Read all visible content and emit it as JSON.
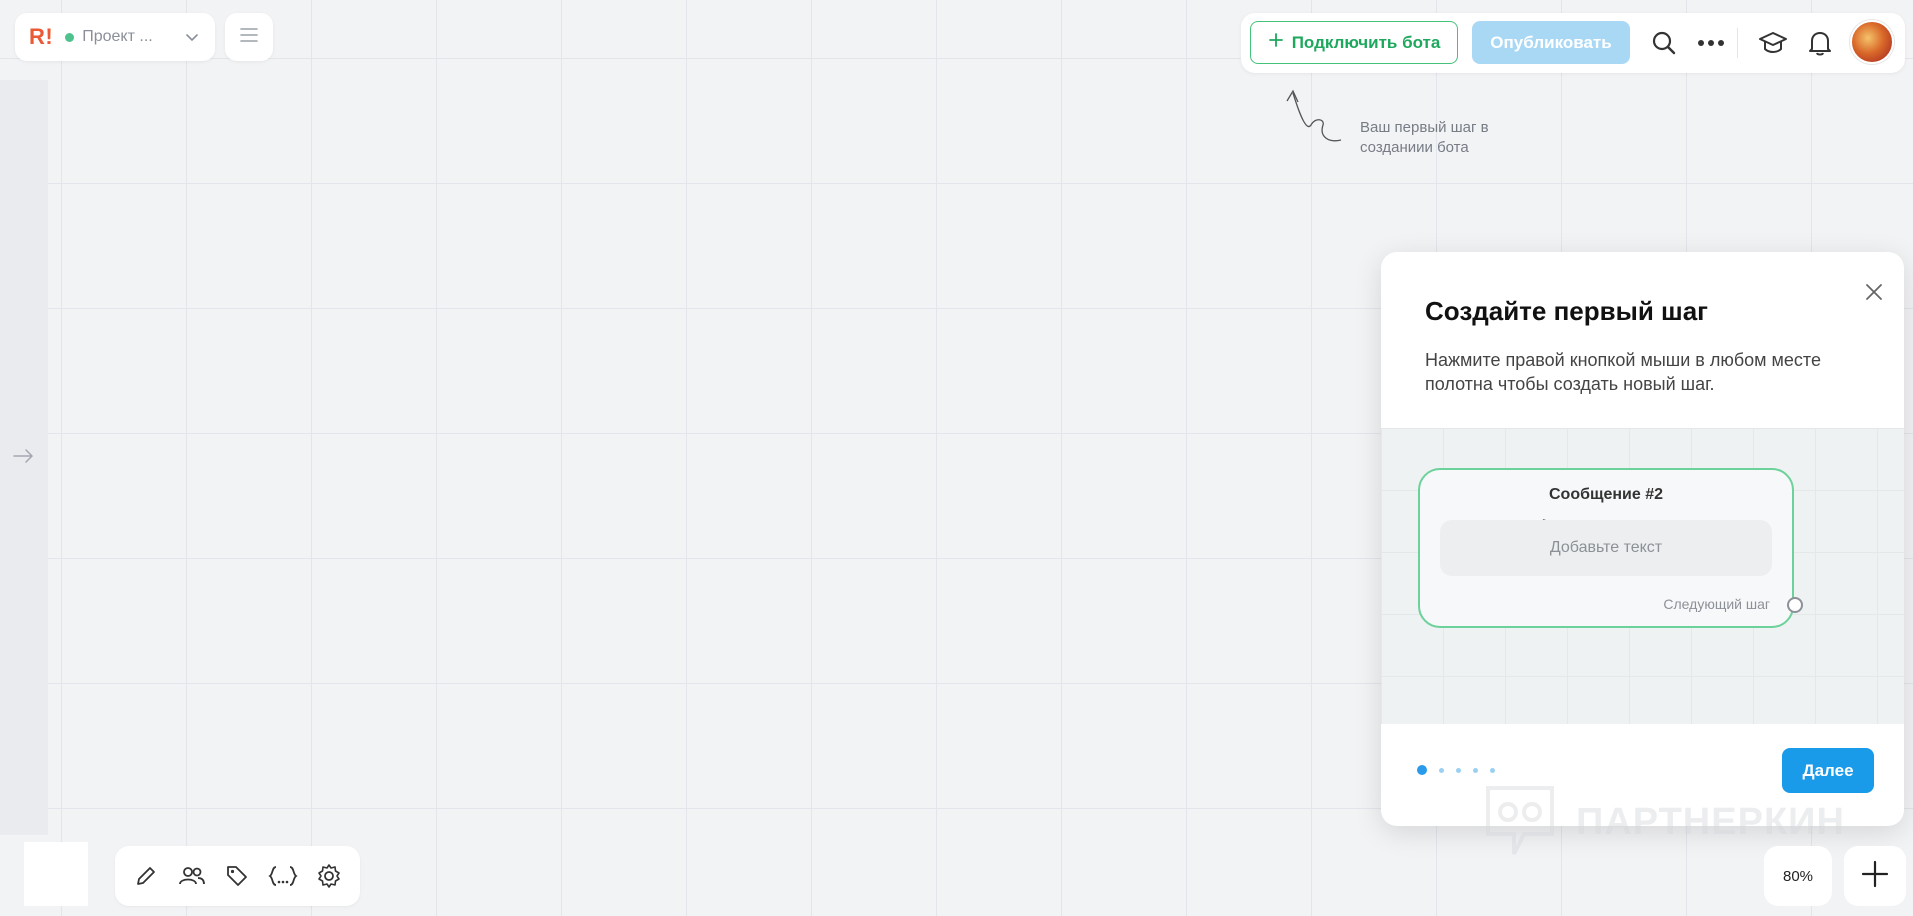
{
  "project": {
    "logo_main": "R",
    "logo_mark": "!",
    "name": "Проект ..."
  },
  "toolbar": {
    "connect_label": "Подключить бота",
    "publish_label": "Опубликовать"
  },
  "hint": {
    "text": "Ваш первый шаг в созданиии бота"
  },
  "onboarding": {
    "title": "Создайте первый шаг",
    "description": "Нажмите правой кнопкой мыши в любом месте полотна чтобы создать новый шаг.",
    "card_title": "Сообщение #2",
    "card_placeholder": "Добавьте текст",
    "card_next": "Следующий шаг",
    "next_label": "Далее",
    "steps_total": 5,
    "step_current": 1
  },
  "watermark": {
    "text": "ПАРТНЕРКИН"
  },
  "zoom": {
    "label": "80%"
  },
  "colors": {
    "accent_green": "#45c27a",
    "accent_blue": "#1a9bea",
    "brand": "#ea5a35",
    "status_online": "#4dc28d"
  },
  "icons": {
    "bottom": [
      "pencil-icon",
      "users-icon",
      "tag-icon",
      "variables-icon",
      "gear-icon"
    ],
    "top": [
      "search-icon",
      "more-icon",
      "graduation-cap-icon",
      "bell-icon"
    ]
  }
}
